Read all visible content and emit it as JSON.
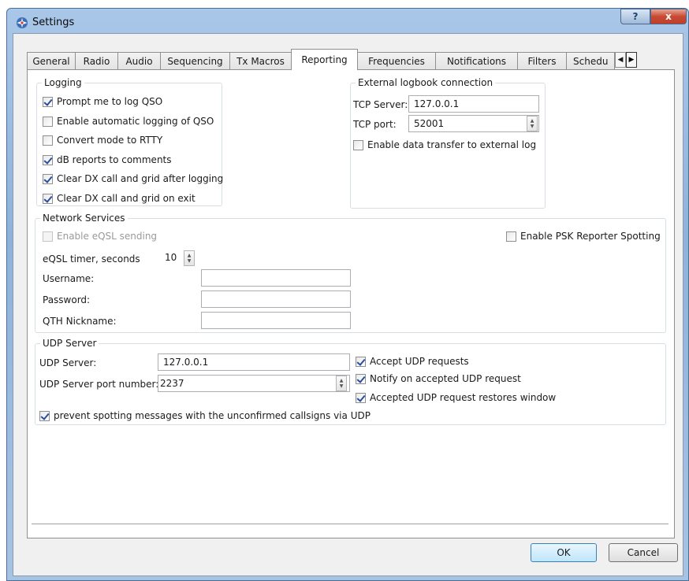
{
  "window": {
    "title": "Settings",
    "help_label": "?",
    "close_label": "x",
    "icon": "settings-gear-icon"
  },
  "tabs": [
    {
      "label": "General"
    },
    {
      "label": "Radio"
    },
    {
      "label": "Audio"
    },
    {
      "label": "Sequencing"
    },
    {
      "label": "Tx Macros"
    },
    {
      "label": "Reporting"
    },
    {
      "label": "Frequencies"
    },
    {
      "label": "Notifications"
    },
    {
      "label": "Filters"
    },
    {
      "label": "Schedu"
    }
  ],
  "active_tab": "Reporting",
  "logging": {
    "title": "Logging",
    "items": [
      {
        "label": "Prompt me to log QSO",
        "checked": true
      },
      {
        "label": "Enable automatic logging of QSO",
        "checked": false
      },
      {
        "label": "Convert mode to RTTY",
        "checked": false
      },
      {
        "label": "dB reports to comments",
        "checked": true
      },
      {
        "label": "Clear DX call and grid after logging",
        "checked": true
      },
      {
        "label": "Clear DX call and grid on exit",
        "checked": true
      }
    ]
  },
  "external": {
    "title": "External logbook connection",
    "tcp_server_label": "TCP Server:",
    "tcp_server_value": "127.0.0.1",
    "tcp_port_label": "TCP port:",
    "tcp_port_value": "52001",
    "enable_transfer_label": "Enable data transfer to external log"
  },
  "network": {
    "title": "Network Services",
    "eqsl_label": "Enable eQSL sending",
    "psk_label": "Enable PSK Reporter Spotting",
    "timer_label": "eQSL timer, seconds",
    "timer_value": "10",
    "username_label": "Username:",
    "password_label": "Password:",
    "qth_label": "QTH Nickname:"
  },
  "udp": {
    "title": "UDP Server",
    "server_label": "UDP Server:",
    "server_value": "127.0.0.1",
    "port_label": "UDP Server port number:",
    "port_value": "2237",
    "accept_label": "Accept UDP requests",
    "notify_label": "Notify on accepted UDP request",
    "restore_label": "Accepted UDP request restores window",
    "prevent_label": "prevent spotting messages with the unconfirmed callsigns via UDP"
  },
  "buttons": {
    "ok": "OK",
    "cancel": "Cancel"
  }
}
